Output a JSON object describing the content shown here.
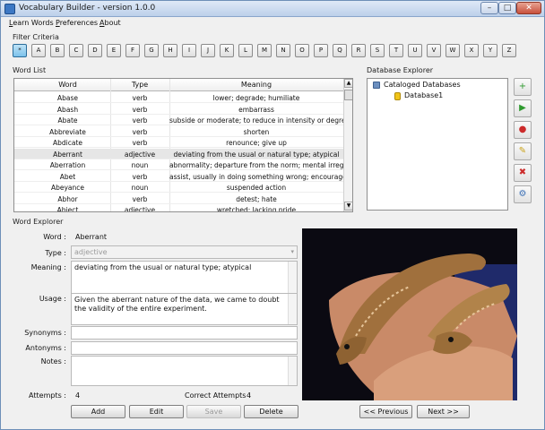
{
  "window": {
    "title": "Vocabulary Builder - version 1.0.0",
    "min_glyph": "–",
    "max_glyph": "□",
    "close_glyph": "✕"
  },
  "menu": [
    {
      "accel": "L",
      "rest": "earn Words"
    },
    {
      "accel": "P",
      "rest": "references"
    },
    {
      "accel": "A",
      "rest": "bout"
    }
  ],
  "filter": {
    "label": "Filter Criteria",
    "letters": [
      "*",
      "A",
      "B",
      "C",
      "D",
      "E",
      "F",
      "G",
      "H",
      "I",
      "J",
      "K",
      "L",
      "M",
      "N",
      "O",
      "P",
      "Q",
      "R",
      "S",
      "T",
      "U",
      "V",
      "W",
      "X",
      "Y",
      "Z"
    ],
    "active": "*"
  },
  "word_list": {
    "label": "Word List",
    "columns": [
      "Word",
      "Type",
      "Meaning"
    ],
    "rows": [
      {
        "word": "Abase",
        "type": "verb",
        "meaning": "lower; degrade; humiliate"
      },
      {
        "word": "Abash",
        "type": "verb",
        "meaning": "embarrass"
      },
      {
        "word": "Abate",
        "type": "verb",
        "meaning": "subside or moderate; to reduce in intensity or degree"
      },
      {
        "word": "Abbreviate",
        "type": "verb",
        "meaning": "shorten"
      },
      {
        "word": "Abdicate",
        "type": "verb",
        "meaning": "renounce; give up"
      },
      {
        "word": "Aberrant",
        "type": "adjective",
        "meaning": "deviating from the usual or natural type; atypical",
        "selected": true
      },
      {
        "word": "Aberration",
        "type": "noun",
        "meaning": "abnormality; departure from the norm; mental irregular..."
      },
      {
        "word": "Abet",
        "type": "verb",
        "meaning": "assist, usually in doing something wrong; encourage"
      },
      {
        "word": "Abeyance",
        "type": "noun",
        "meaning": "suspended action"
      },
      {
        "word": "Abhor",
        "type": "verb",
        "meaning": "detest; hate"
      },
      {
        "word": "Abject",
        "type": "adjective",
        "meaning": "wretched; lacking pride"
      }
    ],
    "scroll_up": "▲",
    "scroll_down": "▼"
  },
  "db_explorer": {
    "label": "Database Explorer",
    "root": "Cataloged Databases",
    "children": [
      "Database1"
    ],
    "tools": [
      {
        "name": "add-tool-button",
        "glyph": "+",
        "color": "#2f9a2f"
      },
      {
        "name": "run-tool-button",
        "glyph": "▶",
        "color": "#2f9a2f"
      },
      {
        "name": "stop-tool-button",
        "glyph": "●",
        "color": "#cc2b2b"
      },
      {
        "name": "edit-tool-button",
        "glyph": "✎",
        "color": "#c9a21a"
      },
      {
        "name": "delete-tool-button",
        "glyph": "✖",
        "color": "#cc2b2b"
      },
      {
        "name": "settings-tool-button",
        "glyph": "⚙",
        "color": "#3a6fb5"
      }
    ]
  },
  "word_explorer": {
    "label": "Word Explorer",
    "word_label": "Word :",
    "word": "Aberrant",
    "type_label": "Type :",
    "type": "adjective",
    "meaning_label": "Meaning :",
    "meaning": "deviating from the usual or natural type; atypical",
    "usage_label": "Usage :",
    "usage": "Given the aberrant nature of the data, we came to doubt the validity of the entire experiment.",
    "synonyms_label": "Synonyms :",
    "synonyms": "",
    "antonyms_label": "Antonyms :",
    "antonyms": "",
    "notes_label": "Notes :",
    "notes": "",
    "attempts_label": "Attempts :",
    "attempts": "4",
    "correct_label": "Correct Attempts :",
    "correct": "4"
  },
  "buttons": {
    "add": "Add",
    "edit": "Edit",
    "save": "Save",
    "delete": "Delete",
    "previous": "<< Previous",
    "next": "Next >>"
  },
  "colors": {
    "selection": "#e6e6e6",
    "db_icon": "#f0c419",
    "image_bg": "#0b0a12"
  }
}
